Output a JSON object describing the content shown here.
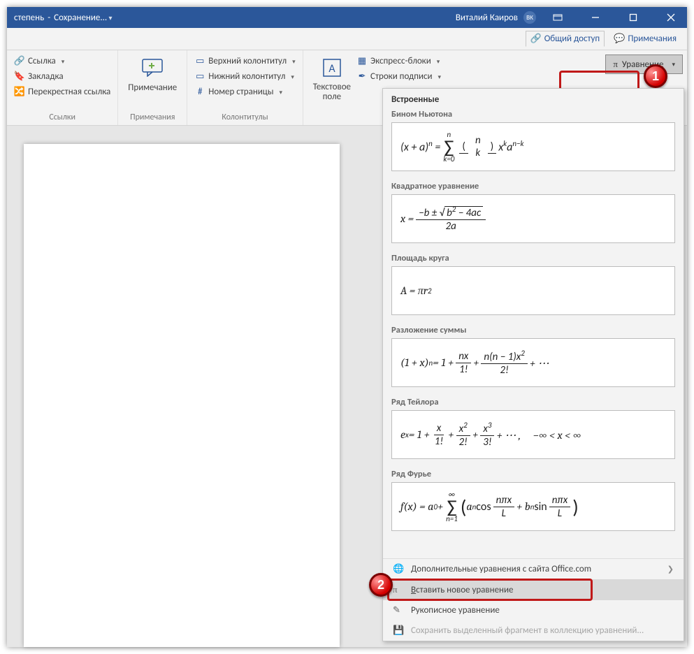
{
  "titlebar": {
    "doc": "степень",
    "status": "Сохранение...",
    "user": "Виталий Каиров",
    "avatar": "ВК"
  },
  "topTabs": {
    "share": "Общий доступ",
    "comments": "Примечания"
  },
  "ribbon": {
    "links": {
      "link": "Ссылка",
      "bookmark": "Закладка",
      "crossref": "Перекрестная ссылка",
      "group": "Ссылки"
    },
    "comments": {
      "comment": "Примечание",
      "group": "Примечания"
    },
    "headers": {
      "header": "Верхний колонтитул",
      "footer": "Нижний колонтитул",
      "page": "Номер страницы",
      "group": "Колонтитулы"
    },
    "text": {
      "textbox": "Текстовое\nполе",
      "quick": "Экспресс-блоки",
      "sign": "Строки подписи"
    },
    "equation": "Уравнение"
  },
  "dropdown": {
    "header": "Встроенные",
    "items": [
      {
        "title": "Бином Ньютона"
      },
      {
        "title": "Квадратное уравнение"
      },
      {
        "title": "Площадь круга"
      },
      {
        "title": "Разложение суммы"
      },
      {
        "title": "Ряд Тейлора"
      },
      {
        "title": "Ряд Фурье"
      }
    ],
    "footer": {
      "more": "Дополнительные уравнения с сайта Office.com",
      "insert": "Вставить новое уравнение",
      "ink": "Рукописное уравнение",
      "save": "Сохранить выделенный фрагмент в коллекцию уравнений..."
    }
  },
  "badges": {
    "one": "1",
    "two": "2"
  }
}
